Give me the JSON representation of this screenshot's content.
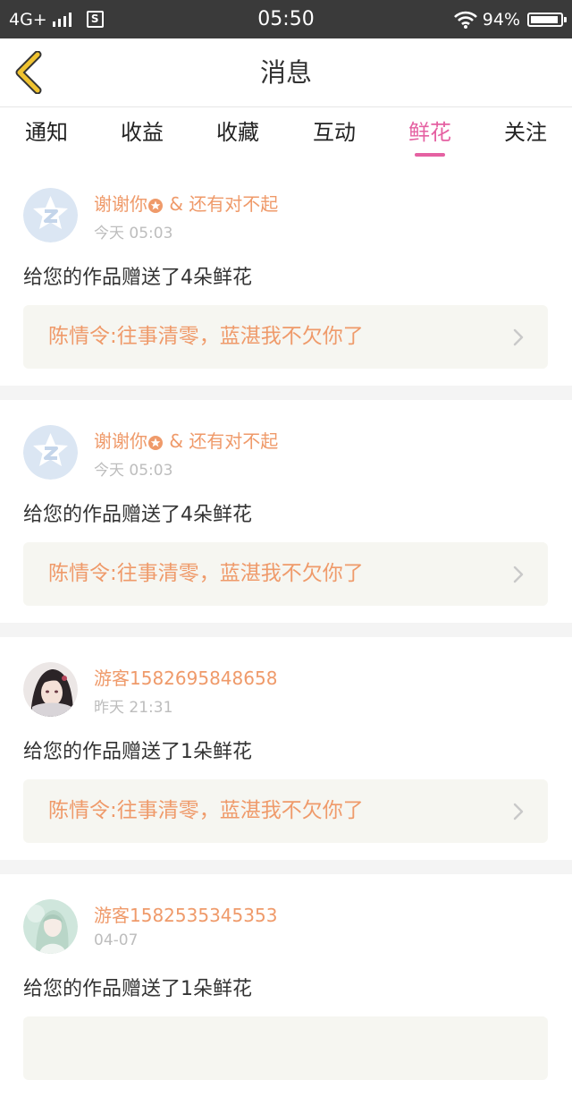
{
  "status_bar": {
    "network": "4G+",
    "time": "05:50",
    "battery_percent": "94%",
    "battery_level": 0.94
  },
  "header": {
    "title": "消息",
    "back_icon": "chevron-left-icon",
    "accent_color": "#f0c330"
  },
  "tabs": [
    {
      "label": "通知",
      "active": false
    },
    {
      "label": "收益",
      "active": false
    },
    {
      "label": "收藏",
      "active": false
    },
    {
      "label": "互动",
      "active": false
    },
    {
      "label": "鲜花",
      "active": true
    },
    {
      "label": "关注",
      "active": false
    }
  ],
  "colors": {
    "active_tab": "#e561a2",
    "sender_name": "#ef9a6a",
    "link_background": "#f6f6f1"
  },
  "notifications": [
    {
      "sender_name": "谢谢你",
      "sender_suffix": "& 还有对不起",
      "has_badge": true,
      "avatar": "default-qq-avatar",
      "time": "今天 05:03",
      "message": "给您的作品赠送了4朵鲜花",
      "work_title": "陈情令:往事清零，蓝湛我不欠你了"
    },
    {
      "sender_name": "谢谢你",
      "sender_suffix": "& 还有对不起",
      "has_badge": true,
      "avatar": "default-qq-avatar",
      "time": "今天 05:03",
      "message": "给您的作品赠送了4朵鲜花",
      "work_title": "陈情令:往事清零，蓝湛我不欠你了"
    },
    {
      "sender_name": "游客1582695848658",
      "sender_suffix": "",
      "has_badge": false,
      "avatar": "anime-character-avatar",
      "time": "昨天 21:31",
      "message": "给您的作品赠送了1朵鲜花",
      "work_title": "陈情令:往事清零，蓝湛我不欠你了"
    },
    {
      "sender_name": "游客1582535345353",
      "sender_suffix": "",
      "has_badge": false,
      "avatar": "anime-girl-avatar",
      "time": "04-07",
      "message": "给您的作品赠送了1朵鲜花",
      "work_title": ""
    }
  ]
}
